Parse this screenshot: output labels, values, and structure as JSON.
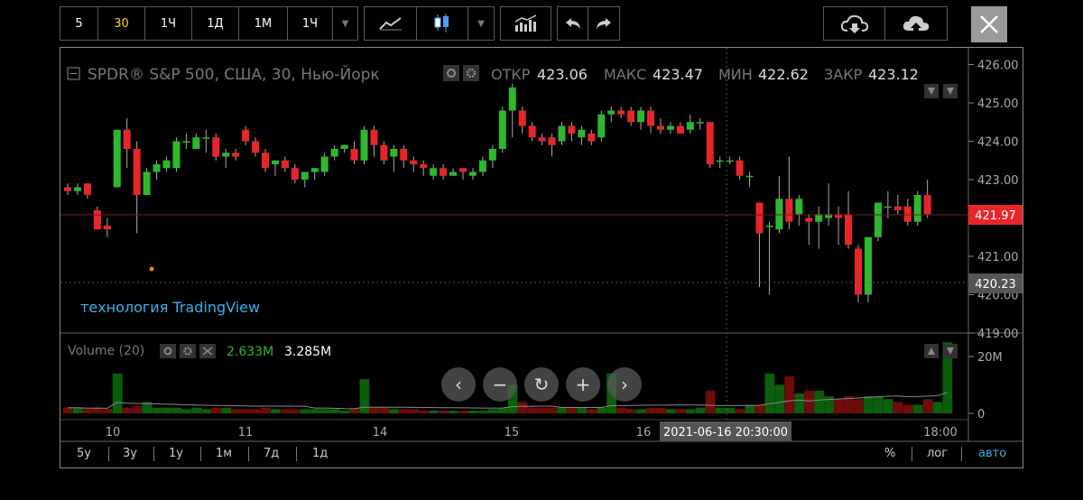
{
  "toolbar": {
    "intervals": [
      "5",
      "30",
      "1Ч",
      "1Д",
      "1М",
      "1Ч"
    ],
    "active_interval": "30"
  },
  "legend": {
    "symbol": "SPDR® S&P 500, США, 30, Нью-Йорк",
    "open_label": "ОТКР",
    "open": "423.06",
    "high_label": "МАКС",
    "high": "423.47",
    "low_label": "МИН",
    "low": "422.62",
    "close_label": "ЗАКР",
    "close": "423.12"
  },
  "watermark": "технология TradingView",
  "volume_legend": {
    "title": "Volume (20)",
    "v1": "2.633M",
    "v2": "3.285M"
  },
  "price_axis": {
    "ticks": [
      "426.00",
      "425.00",
      "424.00",
      "423.00",
      "422.00",
      "421.00",
      "420.00",
      "419.00"
    ],
    "last_price": "421.97",
    "crosshair_price": "420.23"
  },
  "volume_axis": {
    "ticks": [
      "20M",
      "0"
    ]
  },
  "time_axis": {
    "labels": [
      "10",
      "11",
      "14",
      "15",
      "16",
      "18:00"
    ],
    "crosshair_time": "2021-06-16 20:30:00"
  },
  "ranges": [
    "5у",
    "3у",
    "1у",
    "1м",
    "7д",
    "1д"
  ],
  "bottom_right": {
    "percent": "%",
    "log": "лог",
    "auto": "авто"
  },
  "colors": {
    "up": "#2eb82e",
    "down": "#e8262a",
    "vol_up": "#0b5e0b",
    "vol_down": "#6e0c0c",
    "accent": "#3bb0e8",
    "active": "#ffd400"
  },
  "chart_data": {
    "type": "candlestick",
    "title": "SPDR® S&P 500, США, 30, Нью-Йорк",
    "ylim": [
      419.0,
      426.2
    ],
    "candles": [
      [
        422.8,
        422.7,
        422.9,
        422.6
      ],
      [
        422.7,
        422.8,
        422.9,
        422.6
      ],
      [
        422.9,
        422.6,
        422.9,
        422.5
      ],
      [
        422.2,
        421.7,
        422.3,
        421.7
      ],
      [
        421.8,
        421.7,
        422.0,
        421.5
      ],
      [
        422.8,
        424.3,
        424.3,
        422.8
      ],
      [
        424.3,
        423.8,
        424.6,
        423.3
      ],
      [
        423.8,
        422.6,
        424.0,
        421.6
      ],
      [
        422.6,
        423.2,
        423.3,
        422.6
      ],
      [
        423.2,
        423.4,
        423.5,
        423.0
      ],
      [
        423.3,
        423.5,
        423.6,
        423.2
      ],
      [
        423.3,
        424.0,
        424.1,
        423.2
      ],
      [
        424.0,
        424.0,
        424.2,
        423.8
      ],
      [
        423.8,
        424.1,
        424.2,
        423.8
      ],
      [
        424.1,
        424.1,
        424.3,
        423.7
      ],
      [
        424.1,
        423.6,
        424.2,
        423.5
      ],
      [
        423.6,
        423.7,
        423.8,
        423.3
      ],
      [
        423.7,
        423.6,
        423.8,
        423.5
      ],
      [
        424.3,
        424.0,
        424.4,
        423.9
      ],
      [
        424.0,
        423.7,
        424.1,
        423.6
      ],
      [
        423.7,
        423.3,
        423.8,
        423.2
      ],
      [
        423.4,
        423.5,
        423.5,
        423.1
      ],
      [
        423.5,
        423.3,
        423.6,
        423.2
      ],
      [
        423.3,
        423.0,
        423.4,
        422.9
      ],
      [
        423.0,
        423.2,
        423.2,
        422.8
      ],
      [
        423.2,
        423.3,
        423.3,
        423.0
      ],
      [
        423.2,
        423.6,
        423.7,
        423.1
      ],
      [
        423.6,
        423.8,
        423.9,
        423.5
      ],
      [
        423.8,
        423.9,
        423.9,
        423.7
      ],
      [
        423.8,
        423.5,
        424.0,
        423.4
      ],
      [
        423.5,
        424.3,
        424.4,
        423.4
      ],
      [
        424.3,
        423.9,
        424.4,
        423.6
      ],
      [
        423.9,
        423.5,
        424.0,
        423.4
      ],
      [
        423.6,
        423.8,
        423.9,
        423.2
      ],
      [
        423.8,
        423.5,
        423.9,
        423.3
      ],
      [
        423.5,
        423.4,
        423.6,
        423.2
      ],
      [
        423.4,
        423.3,
        423.5,
        423.1
      ],
      [
        423.1,
        423.3,
        423.4,
        423.0
      ],
      [
        423.3,
        423.1,
        423.4,
        423.0
      ],
      [
        423.1,
        423.2,
        423.3,
        423.1
      ],
      [
        423.3,
        423.2,
        423.3,
        423.0
      ],
      [
        423.1,
        423.2,
        423.3,
        423.0
      ],
      [
        423.2,
        423.5,
        423.6,
        423.1
      ],
      [
        423.5,
        423.8,
        423.9,
        423.3
      ],
      [
        423.8,
        424.8,
        424.9,
        423.7
      ],
      [
        424.8,
        425.4,
        425.5,
        424.1
      ],
      [
        424.8,
        424.4,
        424.9,
        424.2
      ],
      [
        424.4,
        424.1,
        424.5,
        424.0
      ],
      [
        424.1,
        424.0,
        424.2,
        423.9
      ],
      [
        424.1,
        423.9,
        424.2,
        423.6
      ],
      [
        424.0,
        424.4,
        424.5,
        423.9
      ],
      [
        424.4,
        424.2,
        424.5,
        424.0
      ],
      [
        424.1,
        424.3,
        424.4,
        423.9
      ],
      [
        424.2,
        424.0,
        424.3,
        423.9
      ],
      [
        424.1,
        424.7,
        424.8,
        424.0
      ],
      [
        424.7,
        424.8,
        424.9,
        424.5
      ],
      [
        424.8,
        424.7,
        424.9,
        424.6
      ],
      [
        424.8,
        424.5,
        424.9,
        424.4
      ],
      [
        424.5,
        424.8,
        424.9,
        424.3
      ],
      [
        424.8,
        424.4,
        424.9,
        424.2
      ],
      [
        424.4,
        424.3,
        424.6,
        424.2
      ],
      [
        424.3,
        424.4,
        424.5,
        424.2
      ],
      [
        424.4,
        424.2,
        424.5,
        424.2
      ],
      [
        424.3,
        424.5,
        424.7,
        424.2
      ],
      [
        424.5,
        424.5,
        424.6,
        424.3
      ],
      [
        424.5,
        423.4,
        424.5,
        423.3
      ],
      [
        423.5,
        423.5,
        423.6,
        423.3
      ],
      [
        423.5,
        423.5,
        423.6,
        423.4
      ],
      [
        423.5,
        423.1,
        423.6,
        423.0
      ],
      [
        423.1,
        423.1,
        423.2,
        422.8
      ],
      [
        422.4,
        421.6,
        422.4,
        420.2
      ],
      [
        421.8,
        421.8,
        421.9,
        420.0
      ],
      [
        421.7,
        422.5,
        423.1,
        421.6
      ],
      [
        422.5,
        421.9,
        423.6,
        421.7
      ],
      [
        422.1,
        422.5,
        422.6,
        421.8
      ],
      [
        422.0,
        421.9,
        422.1,
        421.3
      ],
      [
        421.9,
        422.1,
        422.3,
        421.2
      ],
      [
        422.0,
        422.1,
        422.9,
        421.8
      ],
      [
        422.1,
        422.0,
        422.3,
        421.3
      ],
      [
        422.1,
        421.3,
        422.7,
        421.2
      ],
      [
        421.2,
        420.0,
        421.3,
        419.8
      ],
      [
        420.0,
        421.5,
        421.5,
        419.8
      ],
      [
        421.5,
        422.4,
        422.4,
        421.4
      ],
      [
        422.3,
        422.3,
        422.7,
        422.0
      ],
      [
        422.3,
        422.2,
        422.6,
        422.1
      ],
      [
        422.3,
        421.9,
        422.5,
        421.8
      ],
      [
        421.9,
        422.6,
        422.7,
        421.8
      ],
      [
        422.6,
        422.1,
        423.0,
        422.0
      ]
    ],
    "volume_max": 25,
    "volumes": [
      2,
      2,
      1.5,
      2,
      1.5,
      14,
      2,
      2.5,
      4,
      2,
      2,
      2,
      1.5,
      2,
      1.5,
      2,
      2,
      1.5,
      1.5,
      1.5,
      2,
      1.5,
      1.5,
      1.5,
      1.5,
      1.5,
      1.5,
      1.5,
      1,
      1.5,
      12,
      2,
      2,
      1.5,
      1.5,
      1.5,
      1,
      1,
      1,
      1,
      1,
      1,
      1,
      1.5,
      2,
      10,
      4,
      2,
      2,
      2,
      2,
      2,
      2,
      1.5,
      2,
      14,
      2,
      1.5,
      1.5,
      2,
      2,
      1.5,
      1.5,
      1.5,
      2,
      8,
      2,
      2,
      1.5,
      3,
      3,
      14,
      10,
      13,
      7,
      8,
      8,
      6,
      5,
      6,
      5,
      6,
      6,
      5,
      4,
      3,
      3,
      5,
      4,
      25
    ]
  }
}
